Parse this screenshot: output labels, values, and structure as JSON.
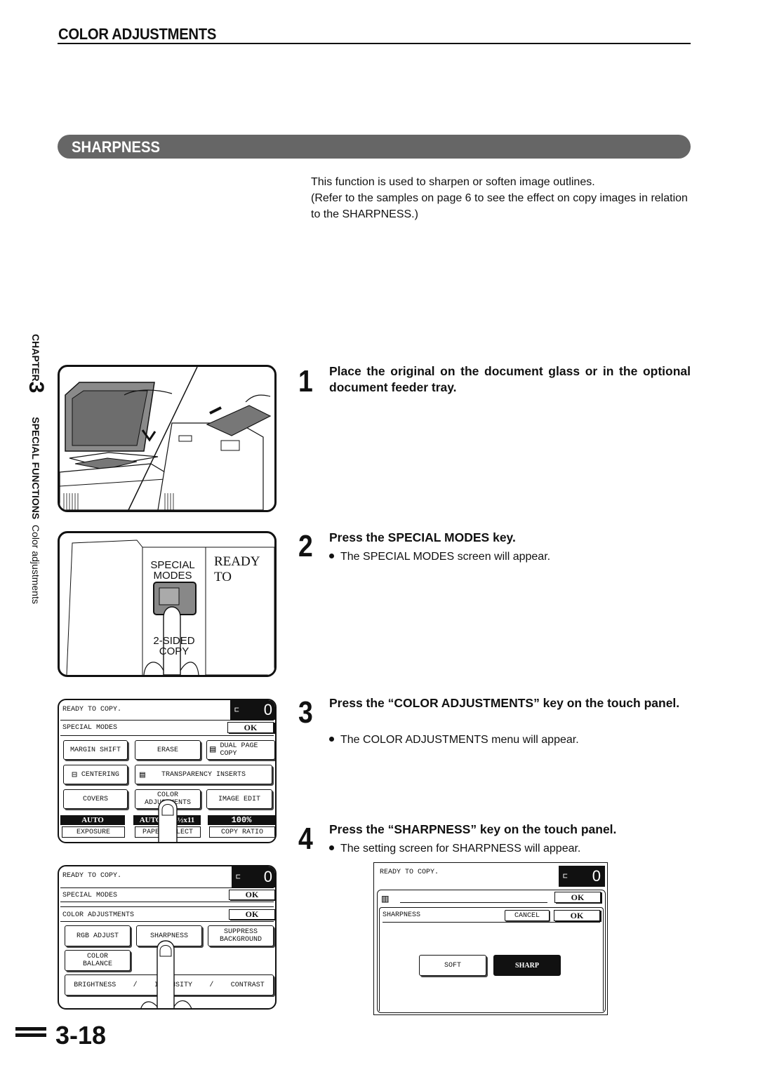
{
  "header": {
    "section_title": "COLOR ADJUSTMENTS",
    "subsection_title": "SHARPNESS"
  },
  "intro": {
    "line1": "This function is used to sharpen or soften image outlines.",
    "line2": "(Refer to the samples on page 6 to see the effect on copy images in relation to the SHARPNESS.)"
  },
  "side_tab": {
    "chapter_label": "CHAPTER",
    "chapter_number": "3",
    "section": "SPECIAL FUNCTIONS",
    "subsection": "Color adjustments"
  },
  "steps": [
    {
      "number": "1",
      "heading": "Place the original on the document glass or in the optional document feeder tray.",
      "bullet": ""
    },
    {
      "number": "2",
      "heading": "Press the SPECIAL MODES key.",
      "bullet": "The SPECIAL MODES screen will appear."
    },
    {
      "number": "3",
      "heading": "Press the “COLOR ADJUSTMENTS” key on the touch panel.",
      "bullet": "The COLOR ADJUSTMENTS menu will appear."
    },
    {
      "number": "4",
      "heading": "Press the “SHARPNESS” key on the touch panel.",
      "bullet": "The setting screen for SHARPNESS will appear."
    }
  ],
  "control_panel": {
    "key_label_line1": "SPECIAL",
    "key_label_line2": "MODES",
    "display_text": "READY TO",
    "below_key_line1": "2-SIDED",
    "below_key_line2": "COPY"
  },
  "panel_special_modes": {
    "status": "READY TO COPY.",
    "count": "0",
    "title": "SPECIAL MODES",
    "ok": "OK",
    "buttons": {
      "margin_shift": "MARGIN SHIFT",
      "erase": "ERASE",
      "dual_page_copy_1": "DUAL PAGE",
      "dual_page_copy_2": "COPY",
      "centering": "CENTERING",
      "transparency_inserts": "TRANSPARENCY INSERTS",
      "covers": "COVERS",
      "color_adjustments_1": "COLOR",
      "color_adjustments_2": "ADJUSTMENTS",
      "image_edit": "IMAGE EDIT"
    },
    "status_bar": {
      "exposure_value": "AUTO",
      "exposure_label": "EXPOSURE",
      "paper_value": "AUTO",
      "paper_size": "8½x11",
      "paper_label": "PAPER SELECT",
      "ratio_value": "100%",
      "ratio_label": "COPY RATIO"
    }
  },
  "panel_color_adjustments": {
    "status": "READY TO COPY.",
    "count": "0",
    "title1": "SPECIAL MODES",
    "title2": "COLOR ADJUSTMENTS",
    "ok": "OK",
    "buttons": {
      "rgb_adjust": "RGB ADJUST",
      "sharpness": "SHARPNESS",
      "suppress_background_1": "SUPPRESS",
      "suppress_background_2": "BACKGROUND",
      "color_balance_1": "COLOR",
      "color_balance_2": "BALANCE",
      "brightness": "BRIGHTNESS",
      "intensity": "INTENSITY",
      "contrast": "CONTRAST",
      "separator": "/"
    }
  },
  "panel_sharpness": {
    "status": "READY TO COPY.",
    "count": "0",
    "ok": "OK",
    "title": "SHARPNESS",
    "cancel": "CANCEL",
    "soft": "SOFT",
    "sharp": "SHARP",
    "selected": "SHARP"
  },
  "page_number": "3-18"
}
